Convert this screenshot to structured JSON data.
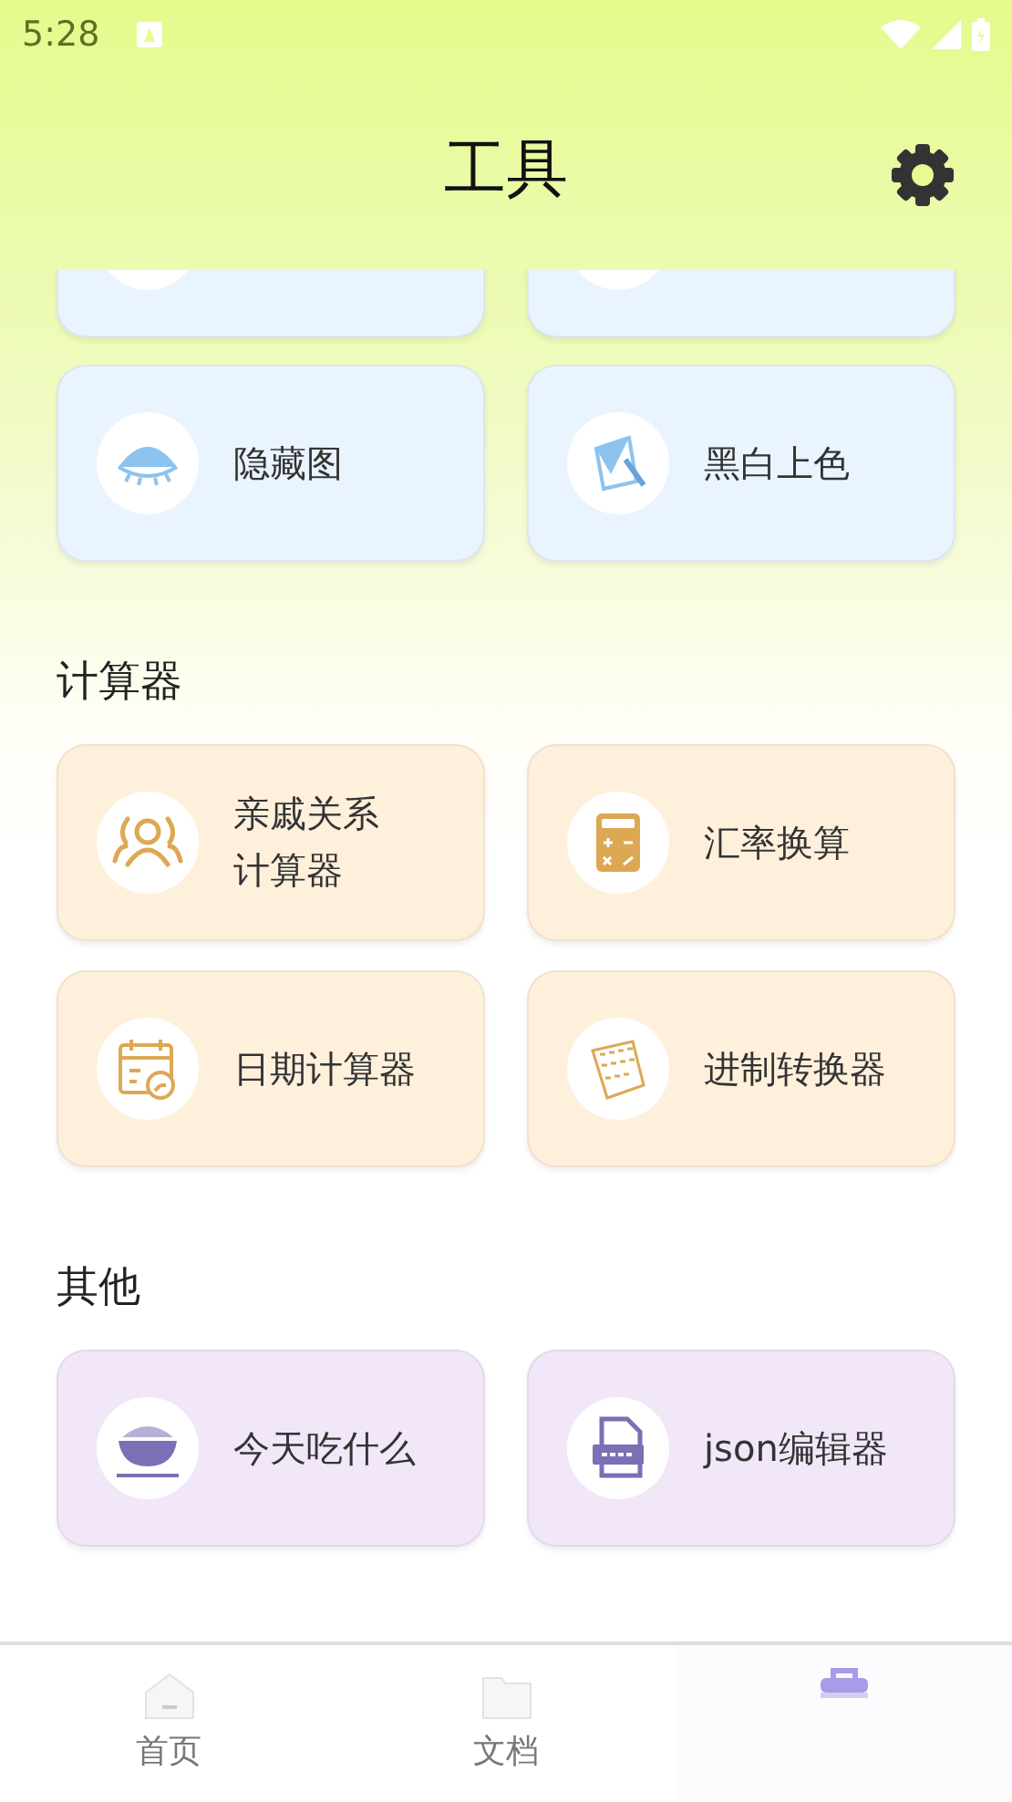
{
  "status_bar": {
    "time": "5:28"
  },
  "header": {
    "title": "工具"
  },
  "sections": [
    {
      "color": "#eaf4ff",
      "items": [
        {
          "kind": "partial"
        },
        {
          "kind": "partial"
        }
      ]
    },
    {
      "color": "#eaf4ff",
      "items": [
        {
          "lines": [
            "隐藏图"
          ]
        },
        {
          "lines": [
            "黑白上色"
          ]
        }
      ]
    },
    {
      "title": "计算器",
      "color": "#fff0dc",
      "items": [
        {
          "lines": [
            "亲戚关系",
            "计算器"
          ]
        },
        {
          "lines": [
            "汇率换算"
          ]
        },
        {
          "lines": [
            "日期计算器"
          ]
        },
        {
          "lines": [
            "进制转换器"
          ]
        }
      ]
    },
    {
      "title": "其他",
      "color": "#f1e7f8",
      "items": [
        {
          "lines": [
            "今天吃什么"
          ]
        },
        {
          "lines": [
            "json编辑器"
          ]
        }
      ]
    }
  ],
  "tabs": [
    {
      "label": "首页",
      "selected": false
    },
    {
      "label": "文档",
      "selected": false
    },
    {
      "selected": true
    }
  ]
}
